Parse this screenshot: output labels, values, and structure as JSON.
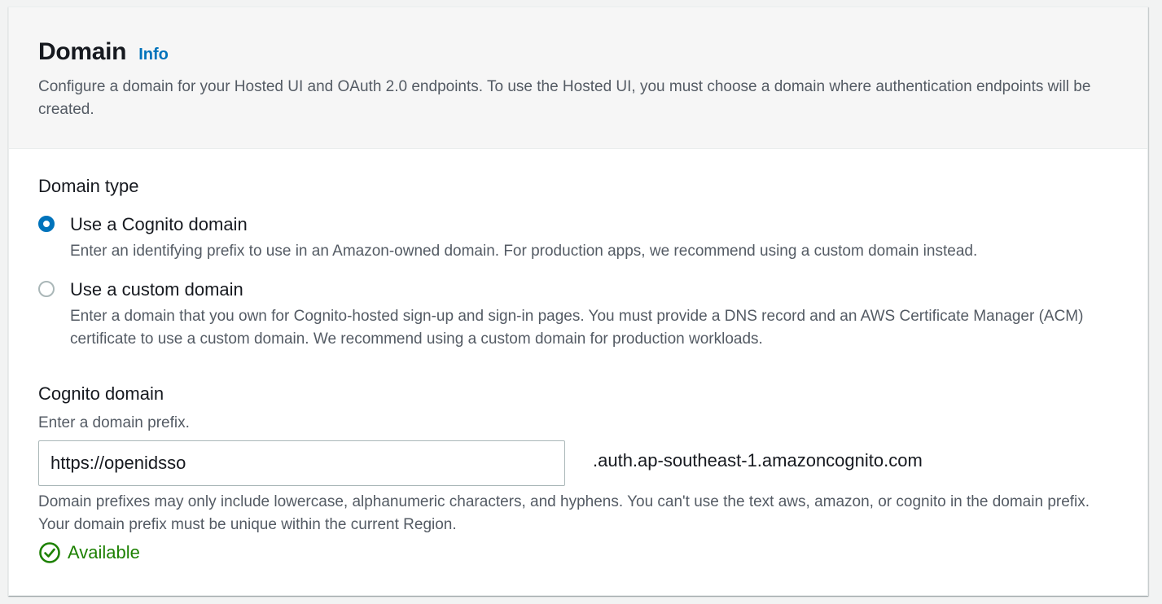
{
  "header": {
    "title": "Domain",
    "info_link": "Info",
    "description": "Configure a domain for your Hosted UI and OAuth 2.0 endpoints. To use the Hosted UI, you must choose a domain where authentication endpoints will be created."
  },
  "domain_type": {
    "label": "Domain type",
    "options": [
      {
        "label": "Use a Cognito domain",
        "description": "Enter an identifying prefix to use in an Amazon-owned domain. For production apps, we recommend using a custom domain instead.",
        "selected": true
      },
      {
        "label": "Use a custom domain",
        "description": "Enter a domain that you own for Cognito-hosted sign-up and sign-in pages. You must provide a DNS record and an AWS Certificate Manager (ACM) certificate to use a custom domain. We recommend using a custom domain for production workloads.",
        "selected": false
      }
    ]
  },
  "cognito_domain": {
    "label": "Cognito domain",
    "hint": "Enter a domain prefix.",
    "value": "https://openidsso",
    "suffix": ".auth.ap-southeast-1.amazoncognito.com",
    "constraint": "Domain prefixes may only include lowercase, alphanumeric characters, and hyphens. You can't use the text aws, amazon, or cognito in the domain prefix. Your domain prefix must be unique within the current Region.",
    "status": "Available",
    "status_icon": "check-circle-icon",
    "status_color": "#1d8102"
  },
  "colors": {
    "accent": "#0073bb",
    "text": "#16191f",
    "secondary_text": "#545b64",
    "success": "#1d8102"
  }
}
